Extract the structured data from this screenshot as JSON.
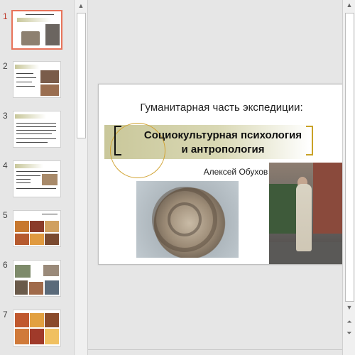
{
  "slides": [
    {
      "number": "1",
      "selected": true
    },
    {
      "number": "2",
      "selected": false
    },
    {
      "number": "3",
      "selected": false
    },
    {
      "number": "4",
      "selected": false
    },
    {
      "number": "5",
      "selected": false
    },
    {
      "number": "6",
      "selected": false
    },
    {
      "number": "7",
      "selected": false
    }
  ],
  "slide": {
    "title": "Гуманитарная часть экспедиции:",
    "subtitle_line1": "Социокультурная психология",
    "subtitle_line2": "и антропология",
    "author": "Алексей Обухов"
  },
  "scrollbar": {
    "up": "▲",
    "down": "▼",
    "prev_slide": "⏶",
    "next_slide": "⏷"
  },
  "colors": {
    "selected_border": "#e8735a",
    "band": "#c9c79a",
    "accent_ring": "#d1a230"
  }
}
